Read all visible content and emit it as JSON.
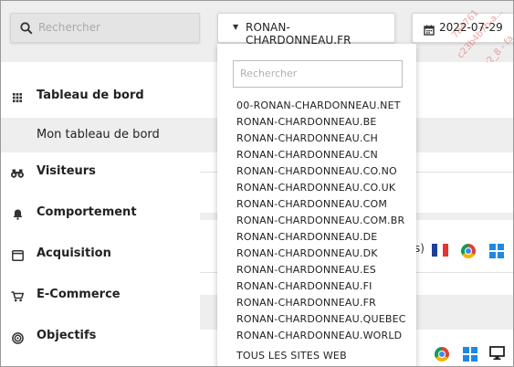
{
  "topbar": {
    "search_placeholder": "Rechercher",
    "site_selector_label": "RONAN-CHARDONNEAU.FR",
    "date_label": "2022-07-29"
  },
  "watermark_lines": [
    "7a4761",
    "c23b4b7b-a...",
    "-st-v2_8 - fa"
  ],
  "sidebar": {
    "items": [
      {
        "label": "Tableau de bord",
        "icon": "grid-icon"
      },
      {
        "label": "Mon tableau de bord"
      },
      {
        "label": "Visiteurs",
        "icon": "binoculars-icon"
      },
      {
        "label": "Comportement",
        "icon": "bell-icon"
      },
      {
        "label": "Acquisition",
        "icon": "window-icon"
      },
      {
        "label": "E-Commerce",
        "icon": "cart-icon"
      },
      {
        "label": "Objectifs",
        "icon": "target-icon"
      }
    ]
  },
  "main": {
    "partial_text": "s)"
  },
  "dropdown": {
    "search_placeholder": "Rechercher",
    "sites": [
      "00-RONAN-CHARDONNEAU.NET",
      "RONAN-CHARDONNEAU.BE",
      "RONAN-CHARDONNEAU.CH",
      "RONAN-CHARDONNEAU.CN",
      "RONAN-CHARDONNEAU.CO.NO",
      "RONAN-CHARDONNEAU.CO.UK",
      "RONAN-CHARDONNEAU.COM",
      "RONAN-CHARDONNEAU.COM.BR",
      "RONAN-CHARDONNEAU.DE",
      "RONAN-CHARDONNEAU.DK",
      "RONAN-CHARDONNEAU.ES",
      "RONAN-CHARDONNEAU.FI",
      "RONAN-CHARDONNEAU.FR",
      "RONAN-CHARDONNEAU.QUEBEC",
      "RONAN-CHARDONNEAU.WORLD"
    ],
    "all_sites_label": "TOUS LES SITES WEB"
  },
  "colors": {
    "accent": "#1e88e5",
    "watermark": "#e04848"
  }
}
